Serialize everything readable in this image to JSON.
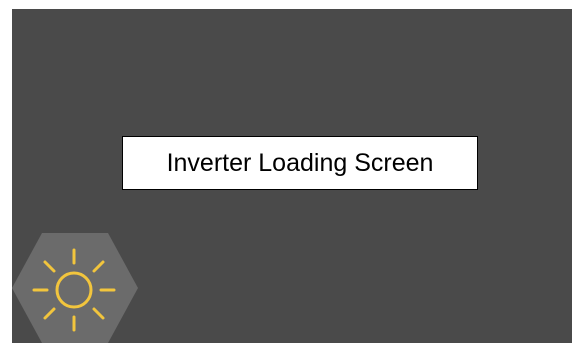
{
  "screen": {
    "title": "Inverter Loading Screen",
    "background_color": "#4a4a4a"
  },
  "badge": {
    "icon": "sun-icon",
    "hexagon_color": "#6b6b6b",
    "sun_color": "#f2c53d"
  }
}
